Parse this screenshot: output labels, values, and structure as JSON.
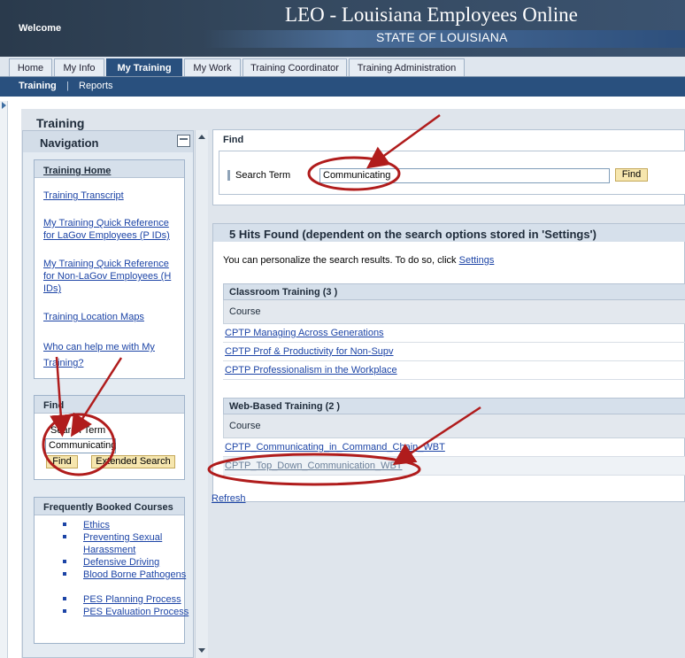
{
  "header": {
    "welcome": "Welcome",
    "title": "LEO - Louisiana Employees Online",
    "subtitle": "STATE OF LOUISIANA"
  },
  "top_nav": {
    "tabs": [
      {
        "label": "Home",
        "active": false
      },
      {
        "label": "My Info",
        "active": false
      },
      {
        "label": "My Training",
        "active": true
      },
      {
        "label": "My Work",
        "active": false
      },
      {
        "label": "Training Coordinator",
        "active": false
      },
      {
        "label": "Training Administration",
        "active": false
      }
    ]
  },
  "sub_nav": {
    "items": [
      "Training",
      "Reports"
    ],
    "separator": "|"
  },
  "page": {
    "title": "Training"
  },
  "navigation": {
    "title": "Navigation",
    "training_home": {
      "heading": "Training Home",
      "links": [
        "Training Transcript",
        "My Training Quick Reference for LaGov Employees (P IDs)",
        "My Training Quick Reference for Non-LaGov Employees (H IDs)",
        "Training Location Maps",
        "Who can help me with My Training?"
      ]
    },
    "find": {
      "heading": "Find",
      "search_label": "Search Term",
      "search_value": "Communicating",
      "find_button": "Find",
      "extended_button": "Extended Search"
    },
    "frequently_booked": {
      "heading": "Frequently Booked Courses",
      "courses": [
        "Ethics",
        "Preventing Sexual Harassment",
        "Defensive Driving",
        "Blood Borne Pathogens",
        "PES Planning Process",
        "PES Evaluation Process"
      ]
    }
  },
  "main": {
    "find": {
      "heading": "Find",
      "search_label": "Search Term",
      "search_value": "Communicating",
      "find_button": "Find"
    },
    "results": {
      "heading": "5 Hits Found (dependent on the search options stored in 'Settings')",
      "note": "You can personalize the search results. To do so, click",
      "settings_link": "Settings",
      "groups": [
        {
          "title": "Classroom Training (3 )",
          "column": "Course",
          "rows": [
            "CPTP Managing Across Generations",
            "CPTP Prof & Productivity for Non-Supv",
            "CPTP Professionalism in the Workplace"
          ]
        },
        {
          "title": "Web-Based Training (2 )",
          "column": "Course",
          "rows": [
            "CPTP_Communicating_in_Command_Chain_WBT",
            "CPTP_Top_Down_Communication_WBT"
          ]
        }
      ]
    },
    "refresh": "Refresh"
  },
  "colors": {
    "header_bg": "#2a3a4c",
    "nav_active": "#29507e",
    "link": "#1c44a6",
    "button": "#f6e6ae",
    "annotation": "#b01c1c"
  },
  "icons": [
    "minimize-icon",
    "scroll-up-icon",
    "scroll-down-icon",
    "expand-arrow-icon"
  ]
}
